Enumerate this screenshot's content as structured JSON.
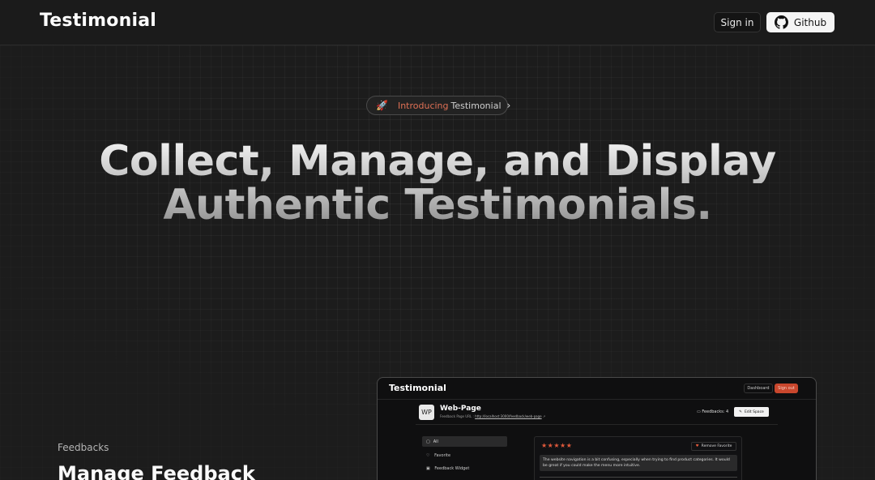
{
  "navbar": {
    "brand": "Testimonial",
    "signin_label": "Sign in",
    "github_label": "Github"
  },
  "badge": {
    "icon": "rocket-icon",
    "highlight": "Introducing",
    "text": "Testimonial",
    "chevron": "›"
  },
  "hero": {
    "line1": "Collect, Manage, and Display",
    "line2": "Authentic Testimonials."
  },
  "section": {
    "kicker": "Feedbacks",
    "title": "Manage Feedback"
  },
  "preview": {
    "brand": "Testimonial",
    "dashboard_label": "Dashboard",
    "signout_label": "Sign out",
    "space_initials": "WP",
    "space_title": "Web-Page",
    "url_label": "Feedback Page URL :",
    "url_value": "http://localhost:3000/feedback/web-page",
    "feedback_count": "Feedbacks: 4",
    "edit_label": "Edit Space",
    "sidebar": {
      "all": "All",
      "favorite": "Favorite",
      "widget": "Feedback Widget"
    },
    "card": {
      "stars": "★★★★★",
      "remove_label": "Remove Favorite",
      "message": "The website navigation is a bit confusing, especially when trying to find product categories. It would be great if you could make the menu more intuitive."
    }
  },
  "colors": {
    "accent": "#e07055",
    "background": "#1c1c1c",
    "star": "#e0593b"
  }
}
